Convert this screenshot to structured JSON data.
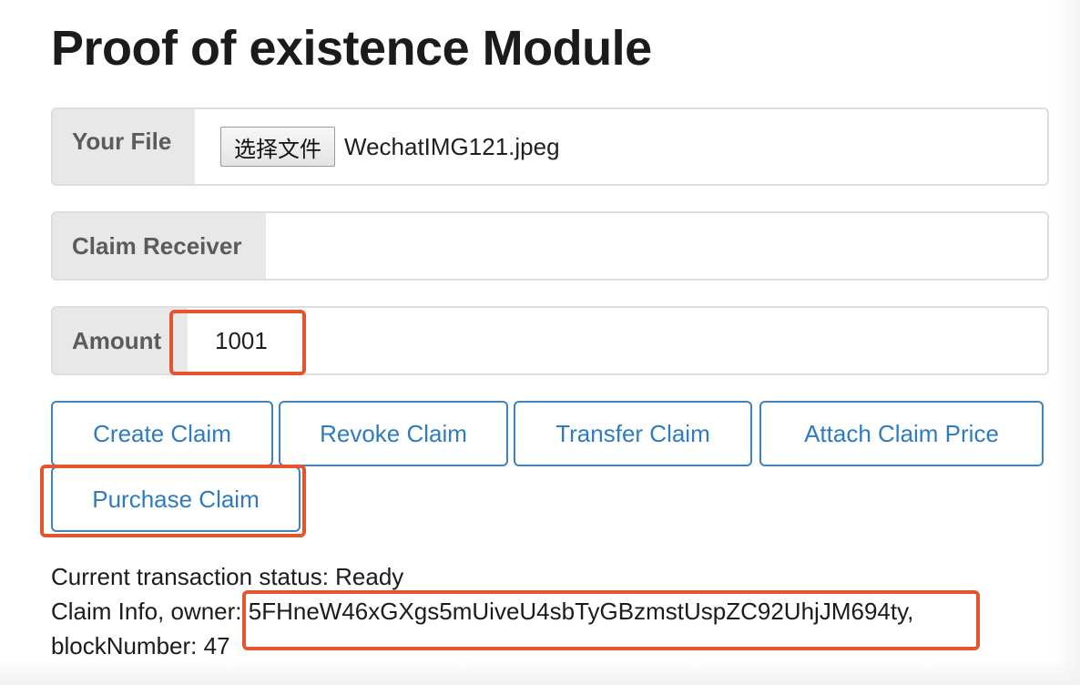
{
  "title": "Proof of existence Module",
  "file_field": {
    "label": "Your File",
    "button_label": "选择文件",
    "file_name": "WechatIMG121.jpeg"
  },
  "receiver_field": {
    "label": "Claim Receiver",
    "value": ""
  },
  "amount_field": {
    "label": "Amount",
    "value": "1001"
  },
  "buttons": {
    "create": "Create Claim",
    "revoke": "Revoke Claim",
    "transfer": "Transfer Claim",
    "attach_price": "Attach Claim Price",
    "purchase": "Purchase Claim"
  },
  "status": {
    "line1": "Current transaction status: Ready",
    "line2": "Claim Info, owner: 5FHneW46xGXgs5mUiveU4sbTyGBzmstUspZC92UhjJM694ty,",
    "line3": "blockNumber: 47"
  },
  "colors": {
    "accent": "#2f7bbf",
    "highlight": "#e2552d",
    "label_bg": "#e8e8e8"
  }
}
